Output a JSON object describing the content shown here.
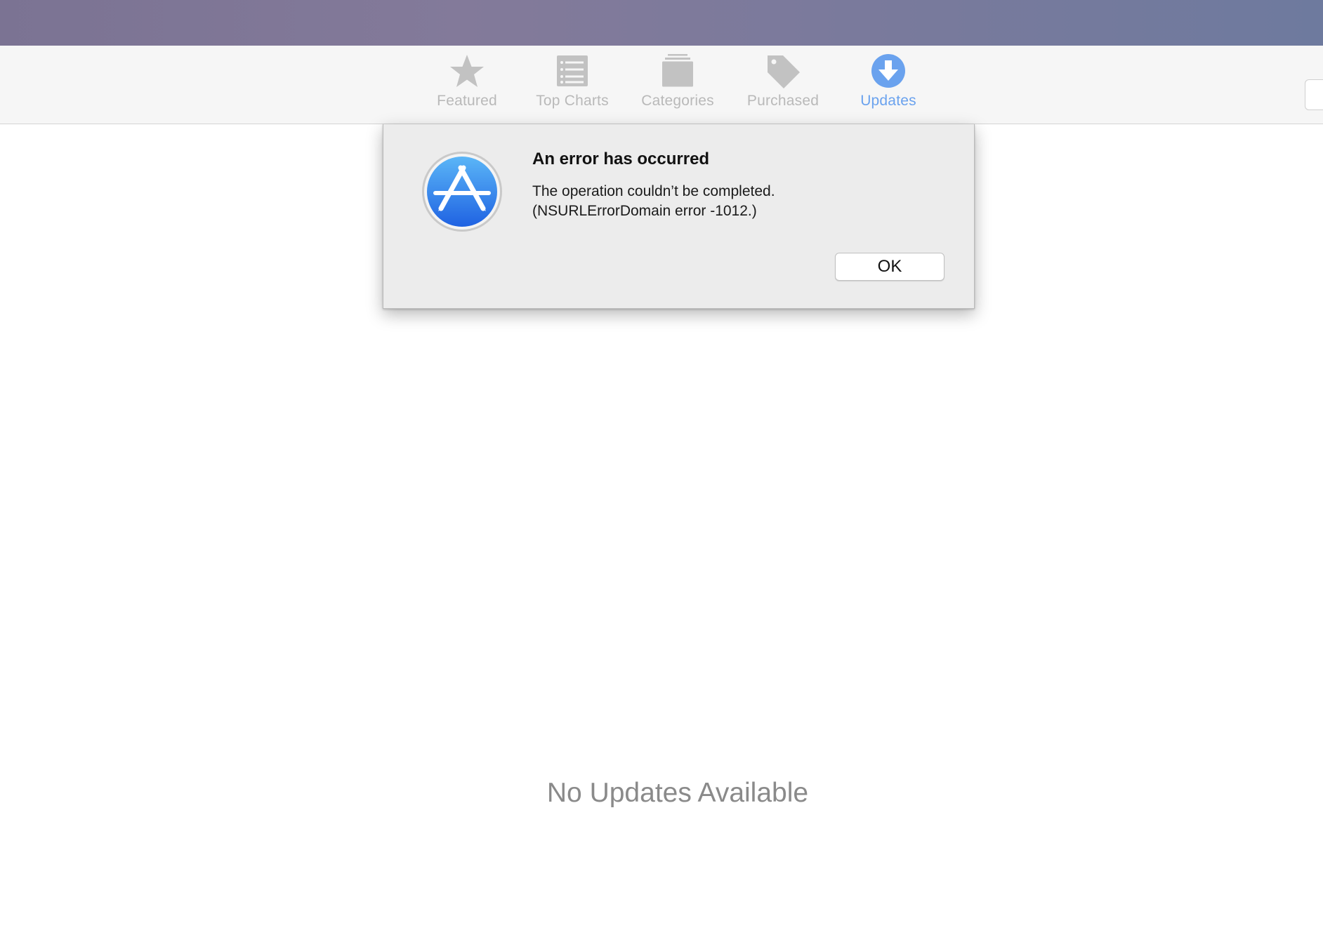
{
  "window": {
    "title": ""
  },
  "toolbar": {
    "tabs": [
      {
        "label": "Featured",
        "icon": "star-icon",
        "active": false
      },
      {
        "label": "Top Charts",
        "icon": "list-icon",
        "active": false
      },
      {
        "label": "Categories",
        "icon": "stack-icon",
        "active": false
      },
      {
        "label": "Purchased",
        "icon": "tag-icon",
        "active": false
      },
      {
        "label": "Updates",
        "icon": "download-arrow-icon",
        "active": true
      }
    ]
  },
  "alert": {
    "icon": "app-store-icon",
    "title": "An error has occurred",
    "message_line1": "The operation couldn’t be completed.",
    "message_line2": "(NSURLErrorDomain error -1012.)",
    "ok_label": "OK"
  },
  "main": {
    "empty_message": "No Updates Available"
  },
  "colors": {
    "active_tab": "#6aa2ee",
    "inactive_tab": "#b9b9b9",
    "app_icon_blue": "#2f7cf0"
  }
}
